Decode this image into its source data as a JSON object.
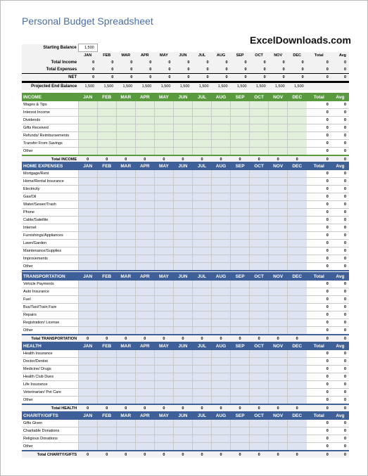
{
  "title": "Personal Budget Spreadsheet",
  "logo_text": "ExcelDownloads.com",
  "months": [
    "JAN",
    "FEB",
    "MAR",
    "APR",
    "MAY",
    "JUN",
    "JUL",
    "AUG",
    "SEP",
    "OCT",
    "NOV",
    "DEC"
  ],
  "total_label": "Total",
  "avg_label": "Avg",
  "summary": {
    "starting_balance_label": "Starting Balance",
    "starting_balance": "1,500",
    "rows": [
      {
        "label": "Total Income",
        "values": [
          "0",
          "0",
          "0",
          "0",
          "0",
          "0",
          "0",
          "0",
          "0",
          "0",
          "0",
          "0"
        ],
        "total": "0",
        "avg": "0"
      },
      {
        "label": "Total Expenses",
        "values": [
          "0",
          "0",
          "0",
          "0",
          "0",
          "0",
          "0",
          "0",
          "0",
          "0",
          "0",
          "0"
        ],
        "total": "0",
        "avg": "0"
      },
      {
        "label": "NET",
        "values": [
          "0",
          "0",
          "0",
          "0",
          "0",
          "0",
          "0",
          "0",
          "0",
          "0",
          "0",
          "0"
        ],
        "total": "0",
        "avg": "0"
      },
      {
        "label": "Projected End Balance",
        "values": [
          "1,500",
          "1,500",
          "1,500",
          "1,500",
          "1,500",
          "1,500",
          "1,500",
          "1,500",
          "1,500",
          "1,500",
          "1,500",
          "1,500"
        ],
        "total": "",
        "avg": ""
      }
    ]
  },
  "colors": {
    "income_header": "#5a9a3f",
    "income_cell": "#e2efda",
    "expense_header": "#3f5f99",
    "expense_cell": "#dde3f0",
    "watermark": "#2e9a5b"
  },
  "sections": [
    {
      "key": "income",
      "title": "INCOME",
      "items": [
        "Wages & Tips",
        "Interest Income",
        "Dividends",
        "Gifts Received",
        "Refunds/ Reimbursements",
        "Transfer From Savings",
        "Other"
      ],
      "item_total": "0",
      "item_avg": "0",
      "total_label": "Total INCOME",
      "totals": [
        "0",
        "0",
        "0",
        "0",
        "0",
        "0",
        "0",
        "0",
        "0",
        "0",
        "0",
        "0"
      ],
      "total": "0",
      "avg": "0"
    },
    {
      "key": "home",
      "title": "HOME EXPENSES",
      "items": [
        "Mortgage/Rent",
        "Home/Rental Insurance",
        "Electricity",
        "Gas/Oil",
        "Water/Sewer/Trash",
        "Phone",
        "Cable/Satellite",
        "Internet",
        "Furnishings/Appliances",
        "Lawn/Garden",
        "Maintenance/Supplies",
        "Improvements",
        "Other"
      ],
      "item_total": "0",
      "item_avg": "0",
      "total_label": "Total HOME EXPENSES",
      "totals": [
        "0",
        "0",
        "0",
        "0",
        "0",
        "0",
        "0",
        "0",
        "0",
        "0",
        "0",
        "0"
      ],
      "total": "0",
      "avg": "0"
    },
    {
      "key": "transport",
      "title": "TRANSPORTATION",
      "items": [
        "Vehicle Payments",
        "Auto Insurance",
        "Fuel",
        "Bus/Taxi/Train Fare",
        "Repairs",
        "Registration/ License",
        "Other"
      ],
      "item_total": "0",
      "item_avg": "0",
      "total_label": "Total TRANSPORTATION",
      "totals": [
        "0",
        "0",
        "0",
        "0",
        "0",
        "0",
        "0",
        "0",
        "0",
        "0",
        "0",
        "0"
      ],
      "total": "0",
      "avg": "0"
    },
    {
      "key": "health",
      "title": "HEALTH",
      "items": [
        "Health Insurance",
        "Doctor/Dentist",
        "Medicine/ Drugs",
        "Health Club Dues",
        "Life Insurance",
        "Veterinarian/ Pet Care",
        "Other"
      ],
      "item_total": "0",
      "item_avg": "0",
      "total_label": "Total HEALTH",
      "totals": [
        "0",
        "0",
        "0",
        "0",
        "0",
        "0",
        "0",
        "0",
        "0",
        "0",
        "0",
        "0"
      ],
      "total": "0",
      "avg": "0"
    },
    {
      "key": "charity",
      "title": "CHARITY/GIFTS",
      "items": [
        "Gifts Given",
        "Charitable Donations",
        "Religious Donations",
        "Other"
      ],
      "item_total": "0",
      "item_avg": "0",
      "total_label": "Total CHARITY/GIFTS",
      "totals": [
        "0",
        "0",
        "0",
        "0",
        "0",
        "0",
        "0",
        "0",
        "0",
        "0",
        "0",
        "0"
      ],
      "total": "0",
      "avg": "0"
    }
  ]
}
